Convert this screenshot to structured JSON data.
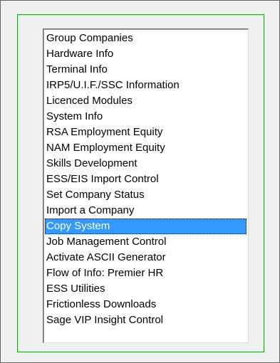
{
  "list": {
    "items": [
      "Group Companies",
      "Hardware Info",
      "Terminal Info",
      "IRP5/U.I.F./SSC Information",
      "Licenced Modules",
      "System Info",
      "RSA Employment Equity",
      "NAM Employment Equity",
      "Skills Development",
      "ESS/EIS Import Control",
      "Set Company Status",
      "Import a Company",
      "Copy System",
      "Job Management Control",
      "Activate ASCII Generator",
      "Flow of Info: Premier HR",
      "ESS Utilities",
      "Frictionless Downloads",
      "Sage VIP Insight Control"
    ],
    "selected_index": 12
  },
  "colors": {
    "selection": "#3399ff",
    "frame_border": "#1f9d1f",
    "background": "#f0f0f0"
  }
}
